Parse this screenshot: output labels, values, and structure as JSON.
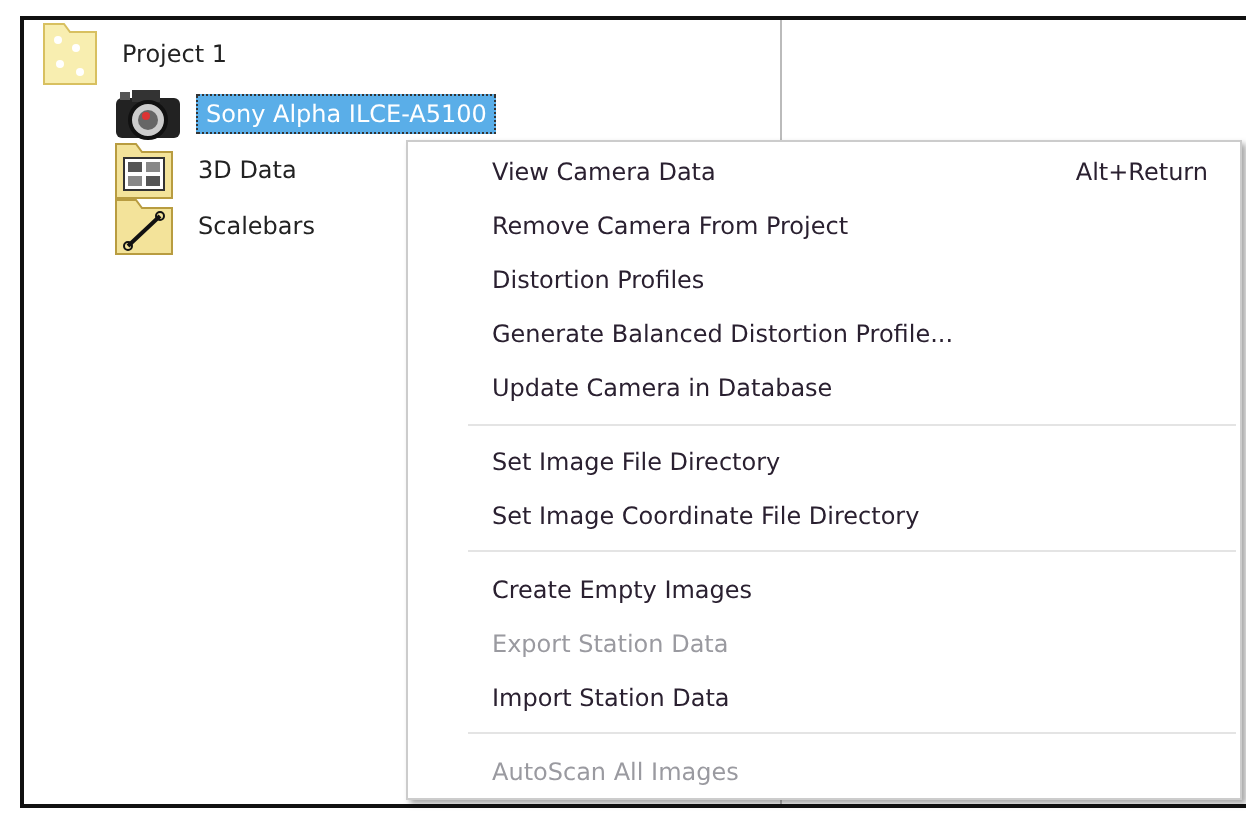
{
  "tree": {
    "label": "Project 1",
    "children": [
      {
        "label": "Sony Alpha ILCE-A5100",
        "kind": "camera",
        "selected": true
      },
      {
        "label": "3D Data",
        "kind": "data",
        "selected": false
      },
      {
        "label": "Scalebars",
        "kind": "scalebar",
        "selected": false
      }
    ]
  },
  "context_menu": [
    {
      "kind": "item",
      "label": "View Camera Data",
      "shortcut": "Alt+Return",
      "disabled": false
    },
    {
      "kind": "item",
      "label": "Remove Camera From Project",
      "disabled": false
    },
    {
      "kind": "item",
      "label": "Distortion Profiles",
      "disabled": false
    },
    {
      "kind": "item",
      "label": "Generate Balanced Distortion Profile...",
      "disabled": false
    },
    {
      "kind": "item",
      "label": "Update Camera in Database",
      "disabled": false
    },
    {
      "kind": "separator"
    },
    {
      "kind": "item",
      "label": "Set Image File Directory",
      "disabled": false
    },
    {
      "kind": "item",
      "label": "Set Image Coordinate File Directory",
      "disabled": false
    },
    {
      "kind": "separator"
    },
    {
      "kind": "item",
      "label": "Create Empty Images",
      "disabled": false
    },
    {
      "kind": "item",
      "label": "Export Station Data",
      "disabled": true
    },
    {
      "kind": "item",
      "label": "Import Station Data",
      "disabled": false
    },
    {
      "kind": "separator"
    },
    {
      "kind": "item",
      "label": "AutoScan All Images",
      "disabled": true
    }
  ]
}
